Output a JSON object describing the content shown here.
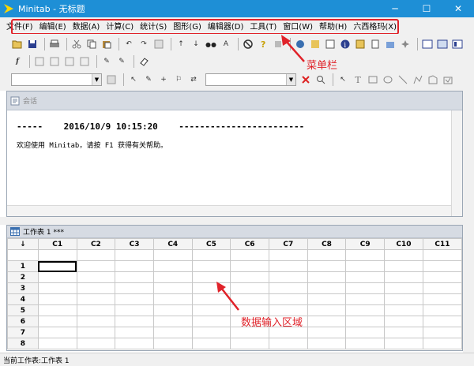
{
  "window": {
    "title": "Minitab - 无标题",
    "minimize_glyph": "─",
    "maximize_glyph": "☐",
    "close_glyph": "✕"
  },
  "menu": {
    "items": [
      "文件(F)",
      "编辑(E)",
      "数据(A)",
      "计算(C)",
      "统计(S)",
      "图形(G)",
      "编辑器(D)",
      "工具(T)",
      "窗口(W)",
      "帮助(H)",
      "六西格玛(X)"
    ]
  },
  "annotations": {
    "menubar_label": "菜单栏",
    "data_area_label": "数据输入区域",
    "accent_color": "#e0232a"
  },
  "session": {
    "title": "会话",
    "header_line": "-----    2016/10/9 10:15:20    ------------------------",
    "welcome_line": "欢迎使用 Minitab，请按 F1 获得有关帮助。"
  },
  "worksheet": {
    "title": "工作表 1 ***",
    "corner": "↓",
    "columns": [
      "C1",
      "C2",
      "C3",
      "C4",
      "C5",
      "C6",
      "C7",
      "C8",
      "C9",
      "C10",
      "C11"
    ],
    "rows": [
      "1",
      "2",
      "3",
      "4",
      "5",
      "6",
      "7",
      "8"
    ]
  },
  "status": {
    "text": "当前工作表:工作表 1"
  },
  "colors": {
    "titlebar": "#1e8fd6",
    "chrome": "#f0f0f0"
  }
}
